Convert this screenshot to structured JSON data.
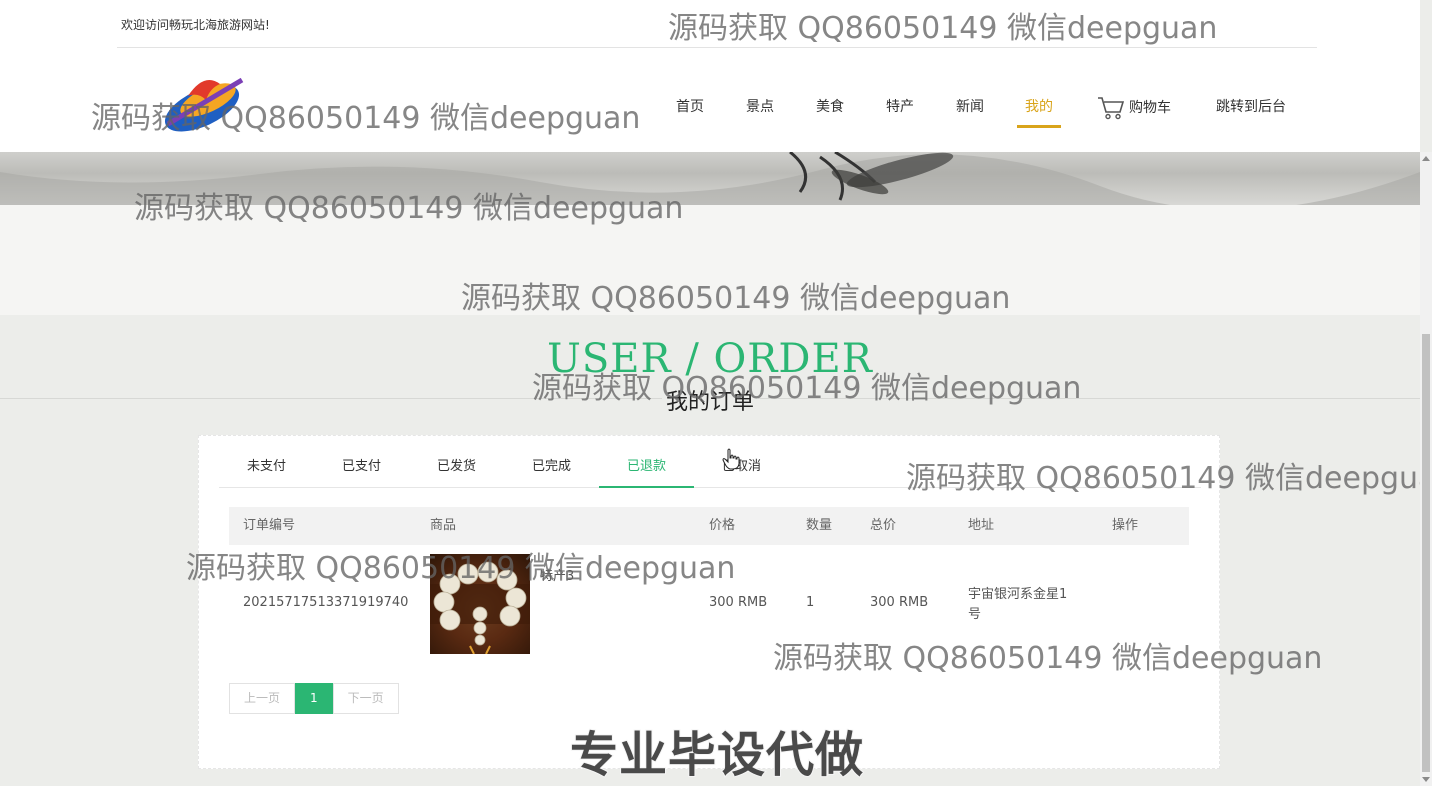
{
  "header": {
    "welcome": "欢迎访问畅玩北海旅游网站!",
    "nav": [
      {
        "label": "首页",
        "active": false
      },
      {
        "label": "景点",
        "active": false
      },
      {
        "label": "美食",
        "active": false
      },
      {
        "label": "特产",
        "active": false
      },
      {
        "label": "新闻",
        "active": false
      },
      {
        "label": "我的",
        "active": true
      }
    ],
    "cart_label": "购物车",
    "admin_link": "跳转到后台"
  },
  "section": {
    "title": "USER / ORDER",
    "subtitle": "我的订单"
  },
  "tabs": [
    "未支付",
    "已支付",
    "已发货",
    "已完成",
    "已退款",
    "已取消"
  ],
  "active_tab": "已退款",
  "table": {
    "headers": [
      "订单编号",
      "商品",
      "价格",
      "数量",
      "总价",
      "地址",
      "操作"
    ],
    "rows": [
      {
        "order_no": "20215717513371919740",
        "product": "特产3",
        "price": "300 RMB",
        "qty": "1",
        "total": "300 RMB",
        "address": "宇宙银河系金星1号",
        "action": ""
      }
    ]
  },
  "pager": {
    "prev": "上一页",
    "current": "1",
    "next": "下一页"
  },
  "watermark": "源码获取 QQ86050149 微信deepguan",
  "banner_text": "专业毕设代做",
  "colors": {
    "accent": "#2bb673",
    "nav_active": "#d9a41b"
  }
}
